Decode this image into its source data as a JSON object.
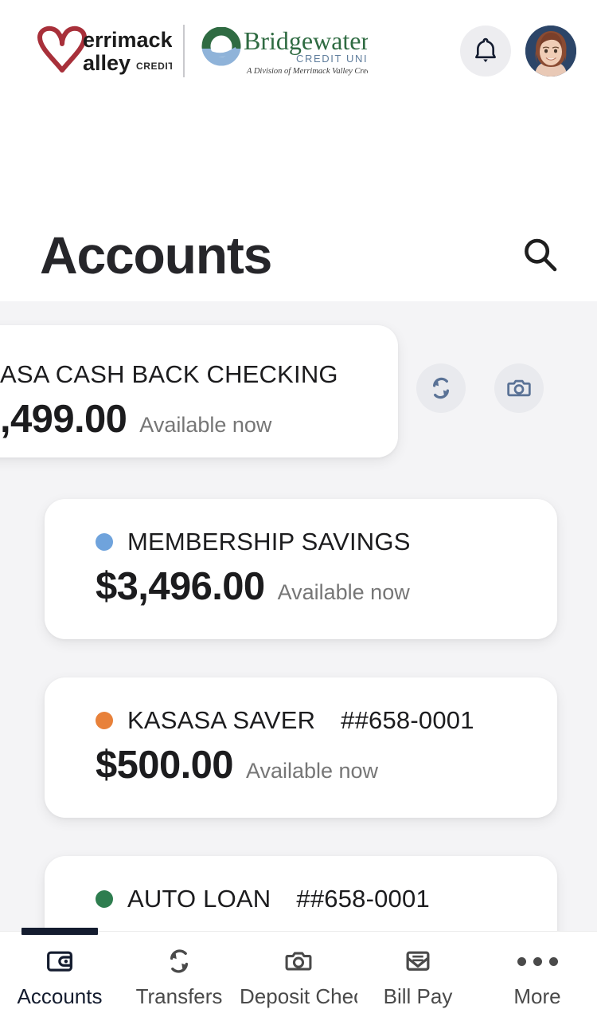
{
  "header": {
    "logo_primary": {
      "name_line1": "errimack",
      "name_line2": "alley",
      "tagline": "CREDIT UNION",
      "color": "#a8303a"
    },
    "logo_secondary": {
      "name": "Bridgewater",
      "tagline": "CREDIT UNION",
      "subtagline": "A Division of Merrimack Valley Credit Union",
      "color": "#2f6b42",
      "accent_color": "#8fb3d9"
    },
    "notifications_icon": "bell-icon",
    "avatar_label": "user-avatar"
  },
  "page": {
    "title": "Accounts",
    "search_icon": "search-icon",
    "background_color": "#f4f4f6"
  },
  "quick_actions": [
    {
      "icon": "transfer-icon",
      "label": "Transfer"
    },
    {
      "icon": "camera-icon",
      "label": "Deposit Check"
    }
  ],
  "accounts": [
    {
      "name": "ASA CASH BACK CHECKING",
      "account_number": "",
      "balance": ",499.00",
      "status": "Available now",
      "dot_color": "transparent",
      "clipped": true
    },
    {
      "name": "MEMBERSHIP SAVINGS",
      "account_number": "",
      "balance": "$3,496.00",
      "status": "Available now",
      "dot_color": "#6fa3dc",
      "clipped": false
    },
    {
      "name": "KASASA SAVER",
      "account_number": "##658-0001",
      "balance": "$500.00",
      "status": "Available now",
      "dot_color": "#e8813a",
      "clipped": false
    },
    {
      "name": "AUTO LOAN",
      "account_number": "##658-0001",
      "balance": "",
      "status": "",
      "dot_color": "#2e7d4f",
      "clipped": false
    }
  ],
  "bottom_nav": {
    "active_index": 0,
    "items": [
      {
        "label": "Accounts",
        "icon": "wallet-icon"
      },
      {
        "label": "Transfers",
        "icon": "transfer-icon"
      },
      {
        "label": "Deposit Check",
        "icon": "camera-icon"
      },
      {
        "label": "Bill Pay",
        "icon": "envelope-icon"
      },
      {
        "label": "More",
        "icon": "ellipsis-icon"
      }
    ]
  }
}
